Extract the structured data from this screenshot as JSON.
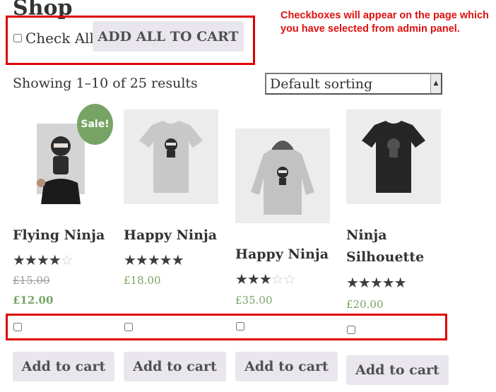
{
  "page": {
    "title": "Shop"
  },
  "annotation": {
    "text": "Checkboxes will appear on the page which you have selected from admin panel."
  },
  "bulk": {
    "check_all_label": "Check All",
    "add_all_label": "ADD ALL TO CART"
  },
  "toolbar": {
    "result_count": "Showing 1–10 of 25 results",
    "sorting_value": "Default sorting"
  },
  "products": [
    {
      "name": "Flying Ninja",
      "rating": 4,
      "old_price": "£15.00",
      "price": "£12.00",
      "on_sale": true,
      "sale_label": "Sale!",
      "image_icon": "ninja-poster",
      "button": "Add to cart"
    },
    {
      "name": "Happy Ninja",
      "rating": 5,
      "price": "£18.00",
      "image_icon": "ninja-tshirt-grey",
      "button": "Add to cart"
    },
    {
      "name": "Happy Ninja",
      "rating": 3,
      "price": "£35.00",
      "image_icon": "ninja-hoodie",
      "button": "Add to cart"
    },
    {
      "name_line1": "Ninja",
      "name_line2": "Silhouette",
      "rating": 5,
      "price": "£20.00",
      "image_icon": "ninja-tshirt-black",
      "button": "Add to cart"
    }
  ],
  "colors": {
    "accent_green": "#77a464",
    "annotation_red": "#e01010",
    "button_bg": "#e9e6ed"
  }
}
